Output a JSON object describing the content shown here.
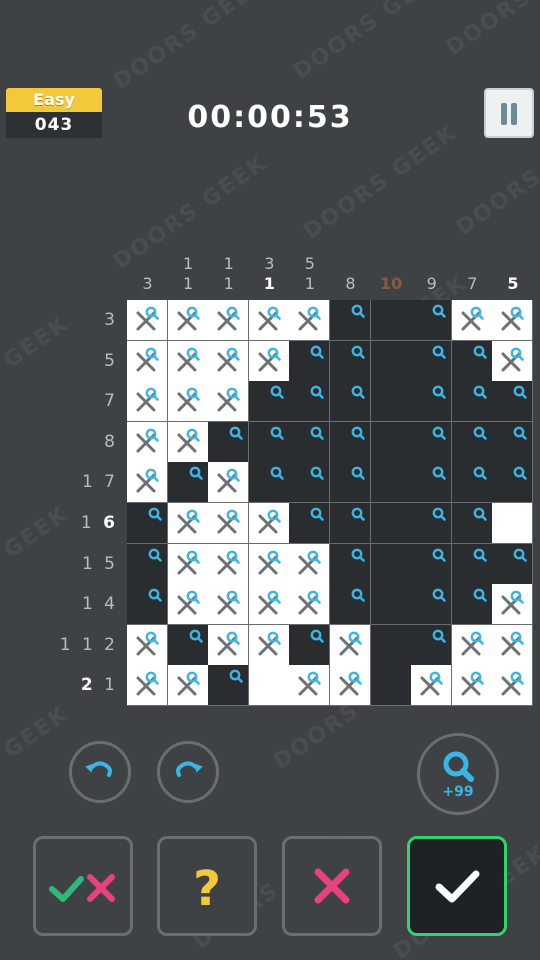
{
  "level": {
    "difficulty": "Easy",
    "number": "043"
  },
  "timer": "00:00:53",
  "col_clues": [
    {
      "nums": [
        "3"
      ],
      "done": false
    },
    {
      "nums": [
        "1",
        "1"
      ],
      "done": false
    },
    {
      "nums": [
        "1",
        "1"
      ],
      "done": false
    },
    {
      "nums": [
        "3",
        "1"
      ],
      "done": "partial"
    },
    {
      "nums": [
        "5",
        "1"
      ],
      "done": false
    },
    {
      "nums": [
        "8"
      ],
      "done": false
    },
    {
      "nums": [
        "10"
      ],
      "done": "warn"
    },
    {
      "nums": [
        "9"
      ],
      "done": false
    },
    {
      "nums": [
        "7"
      ],
      "done": false
    },
    {
      "nums": [
        "5"
      ],
      "done": true
    }
  ],
  "row_clues": [
    {
      "text": "3",
      "done": false
    },
    {
      "text": "5",
      "done": false
    },
    {
      "text": "7",
      "done": false
    },
    {
      "text": "8",
      "done": false
    },
    {
      "text": "1 7",
      "done": false
    },
    {
      "text": "1",
      "strong": "6"
    },
    {
      "text": "1 5",
      "done": false
    },
    {
      "text": "1 4",
      "done": false
    },
    {
      "text": "1 1 2",
      "done": false
    },
    {
      "text": "",
      "strongPrefix": "2",
      "rest": "1"
    }
  ],
  "grid": [
    "xxxxxfdfxx",
    "xxxxffdffx",
    "xxxfffdfff",
    "xxffffdfff",
    "xfxfffdfff",
    "fxxxffdffe",
    "fxxxxfdfff",
    "fxxxxfdffx",
    "xfxxfxdfxx",
    "xxfexxdxxx"
  ],
  "hint": {
    "count": "+99"
  },
  "colors": {
    "accent_blue": "#3ab5e6",
    "check_green": "#2fd46b",
    "cross_pink": "#e8417f",
    "gold": "#f3c93b"
  },
  "buttons": {
    "undo": "undo-icon",
    "redo": "redo-icon",
    "hint": "magnifier-hint-icon",
    "check_cross_mode": "check-cross-icon",
    "question": "?",
    "cross_mode": "cross-icon",
    "fill_mode": "check-icon"
  }
}
